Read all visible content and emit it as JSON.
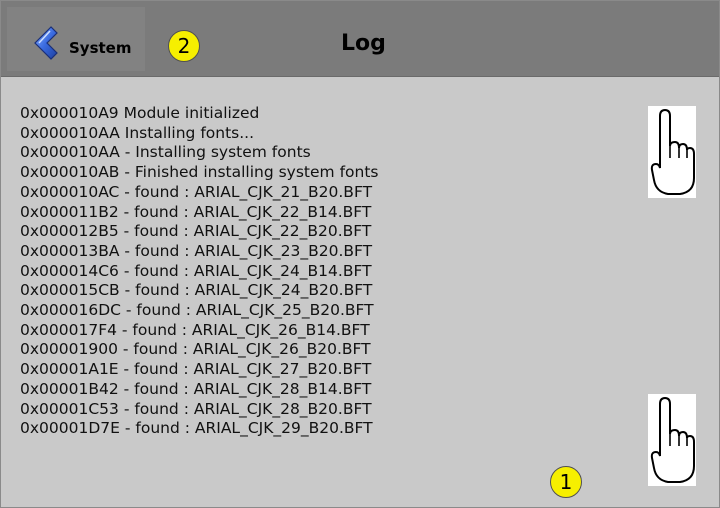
{
  "header": {
    "back_label": "System",
    "title": "Log",
    "badge": "2"
  },
  "footer_badge": "1",
  "log_lines": [
    "0x000010A9 Module initialized",
    "0x000010AA Installing fonts...",
    "0x000010AA - Installing system fonts",
    "0x000010AB - Finished installing system fonts",
    "0x000010AC - found : ARIAL_CJK_21_B20.BFT",
    "0x000011B2 - found : ARIAL_CJK_22_B14.BFT",
    "0x000012B5 - found : ARIAL_CJK_22_B20.BFT",
    "0x000013BA - found : ARIAL_CJK_23_B20.BFT",
    "0x000014C6 - found : ARIAL_CJK_24_B14.BFT",
    "0x000015CB - found : ARIAL_CJK_24_B20.BFT",
    "0x000016DC - found : ARIAL_CJK_25_B20.BFT",
    "0x000017F4 - found : ARIAL_CJK_26_B14.BFT",
    "0x00001900 - found : ARIAL_CJK_26_B20.BFT",
    "0x00001A1E - found : ARIAL_CJK_27_B20.BFT",
    "0x00001B42 - found : ARIAL_CJK_28_B14.BFT",
    "0x00001C53 - found : ARIAL_CJK_28_B20.BFT",
    "0x00001D7E - found : ARIAL_CJK_29_B20.BFT"
  ],
  "icons": {
    "back": "chevron-left-icon",
    "hand": "pointing-hand-icon"
  },
  "colors": {
    "titlebar": "#7b7b7b",
    "background": "#c9c9c9",
    "badge": "#f6ef00",
    "arrow": "#2f5fd0"
  }
}
